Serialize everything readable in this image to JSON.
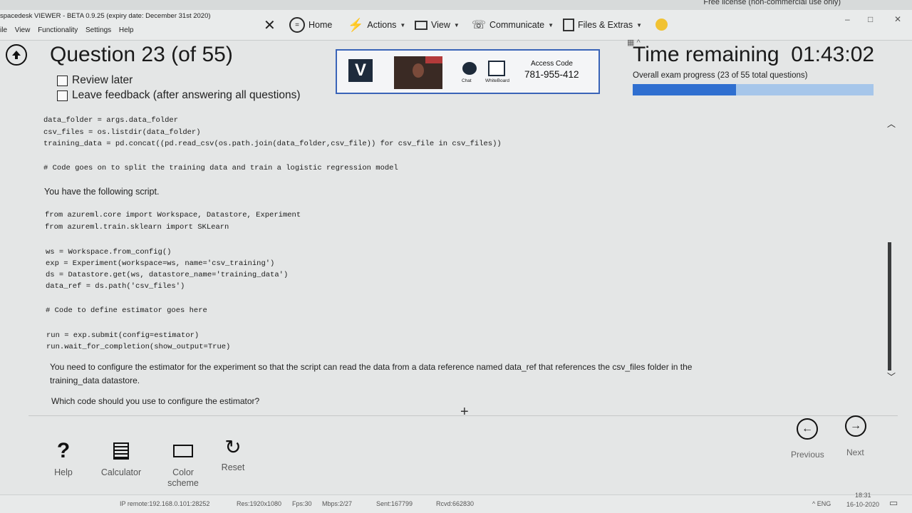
{
  "license_text": "Free license (non-commercial use only)",
  "app": {
    "title": "spacedesk VIEWER - BETA 0.9.25 (expiry date: December 31st 2020)",
    "menu": [
      "ile",
      "View",
      "Functionality",
      "Settings",
      "Help"
    ]
  },
  "toolbar": {
    "close_glyph": "✕",
    "home": "Home",
    "actions": "Actions",
    "view": "View",
    "communicate": "Communicate",
    "files": "Files & Extras"
  },
  "window_controls": [
    "–",
    "□",
    "✕"
  ],
  "exam": {
    "question_title": "Question 23 (of 55)",
    "review_later": "Review later",
    "leave_feedback": "Leave feedback (after answering all questions)",
    "time_label": "Time remaining",
    "time_value": "01:43:02",
    "overall_progress": "Overall exam progress (23 of 55 total questions)",
    "progress_fraction": 0.43
  },
  "proctor": {
    "logo": "V",
    "chat": "Chat",
    "whiteboard": "WhiteBoard",
    "access_code_label": "Access Code",
    "access_code": "781-955-412"
  },
  "question": {
    "code_top": [
      "data_folder = args.data_folder",
      "csv_files = os.listdir(data_folder)",
      "training_data = pd.concat((pd.read_csv(os.path.join(data_folder,csv_file)) for csv_file in csv_files))"
    ],
    "code_comment_1": "# Code goes on to split the training data and train a logistic regression model",
    "intro": "You have the following script.",
    "code_imports": [
      "from azureml.core import Workspace, Datastore, Experiment",
      "from azureml.train.sklearn import SKLearn"
    ],
    "code_setup": [
      "ws = Workspace.from_config()",
      "exp = Experiment(workspace=ws, name='csv_training')",
      "ds = Datastore.get(ws, datastore_name='training_data')",
      "data_ref = ds.path('csv_files')"
    ],
    "code_comment_2": "# Code to define estimator goes here",
    "code_run": [
      "run = exp.submit(config=estimator)",
      "run.wait_for_completion(show_output=True)"
    ],
    "requirement_1": "You need to configure the estimator for the experiment so that the script can read the data from a data reference named data_ref that references the csv_files folder in the",
    "requirement_2": "training_data datastore.",
    "prompt": "Which code should you use to configure the estimator?"
  },
  "tools": {
    "help": "Help",
    "calculator": "Calculator",
    "color_scheme": "Color scheme",
    "reset": "Reset"
  },
  "nav": {
    "previous": "Previous",
    "next": "Next"
  },
  "taskbar": {
    "ip": "IP remote:192.168.0.101:28252",
    "res": "Res:1920x1080",
    "fps": "Fps:30",
    "mbps": "Mbps:2/27",
    "sent": "Sent:167799",
    "rcvd": "Rcvd:662830",
    "lang": "ENG",
    "time": "18:31",
    "date": "16-10-2020"
  }
}
